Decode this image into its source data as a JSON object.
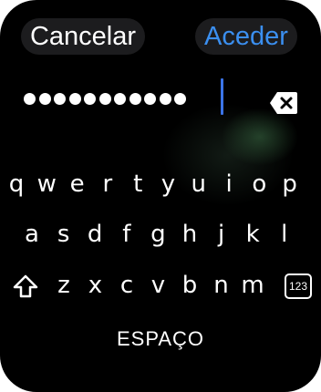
{
  "header": {
    "cancel_label": "Cancelar",
    "confirm_label": "Aceder"
  },
  "password_field": {
    "masked_char_count": 11
  },
  "keyboard": {
    "row1": [
      "q",
      "w",
      "e",
      "r",
      "t",
      "y",
      "u",
      "i",
      "o",
      "p"
    ],
    "row2": [
      "a",
      "s",
      "d",
      "f",
      "g",
      "h",
      "j",
      "k",
      "l"
    ],
    "row3": [
      "z",
      "x",
      "c",
      "v",
      "b",
      "n",
      "m"
    ],
    "numbers_key_label": "123",
    "space_label": "ESPAÇO"
  },
  "colors": {
    "background": "#000000",
    "pill": "#1c1c1e",
    "accent": "#3b8ff0",
    "cursor": "#3b74e8",
    "text": "#ffffff"
  },
  "icons": {
    "backspace": "backspace-icon",
    "shift": "shift-icon"
  }
}
